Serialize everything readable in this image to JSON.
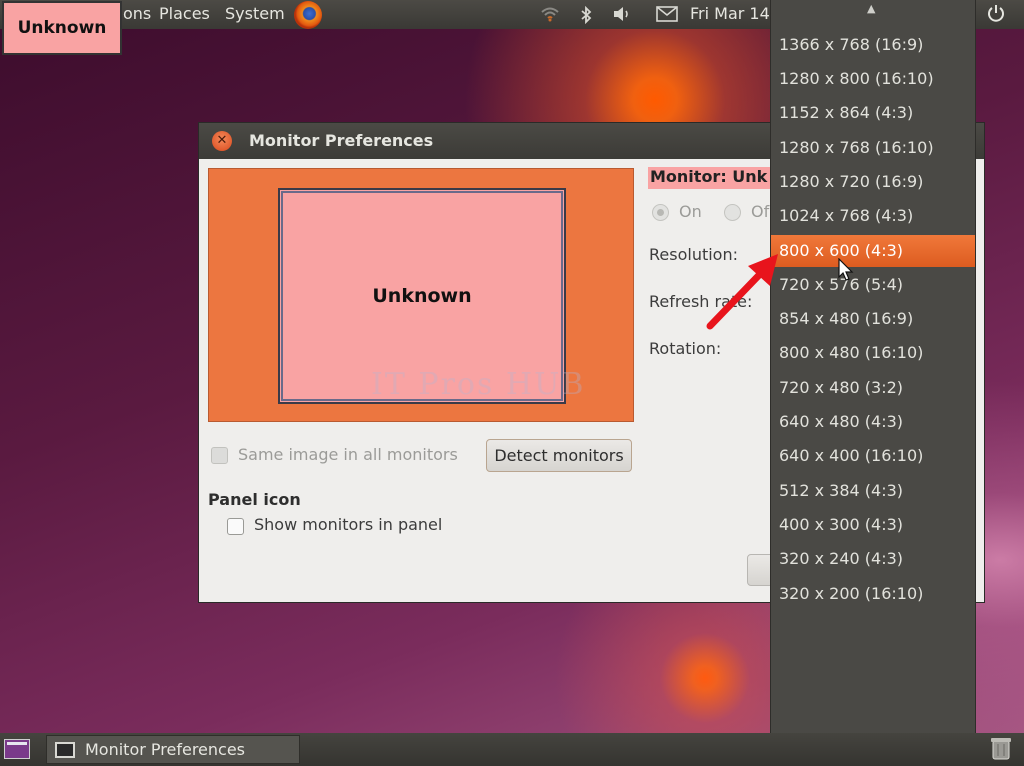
{
  "top_panel": {
    "menu_applications_partial": "ons",
    "menu_places": "Places",
    "menu_system": "System",
    "clock": "Fri Mar 14",
    "icons": [
      "firefox-icon",
      "wifi-icon",
      "bluetooth-icon",
      "volume-icon",
      "mail-icon",
      "power-icon"
    ]
  },
  "overlay_badge": {
    "label": "Unknown"
  },
  "window": {
    "title": "Monitor Preferences",
    "preview_monitor_label": "Unknown",
    "watermark": "IT Pros HUB",
    "monitor_label": "Monitor: Unk",
    "radio_on": "On",
    "radio_off": "Of",
    "radio_on_selected": true,
    "resolution_label": "Resolution:",
    "refresh_label": "Refresh rate:",
    "rotation_label": "Rotation:",
    "same_image_label": "Same image in all monitors",
    "same_image_checked": false,
    "detect_button": "Detect monitors",
    "panel_icon_heading": "Panel icon",
    "show_monitors_label": "Show monitors in panel",
    "show_monitors_checked": false
  },
  "resolution_dropdown": {
    "selected_index": 6,
    "options": [
      "1366 x 768 (16:9)",
      "1280 x 800 (16:10)",
      "1152 x 864 (4:3)",
      "1280 x 768 (16:10)",
      "1280 x 720 (16:9)",
      "1024 x 768 (4:3)",
      "800 x 600 (4:3)",
      "720 x 576 (5:4)",
      "854 x 480 (16:9)",
      "800 x 480 (16:10)",
      "720 x 480 (3:2)",
      "640 x 480 (4:3)",
      "640 x 400 (16:10)",
      "512 x 384 (4:3)",
      "400 x 300 (4:3)",
      "320 x 240 (4:3)",
      "320 x 200 (16:10)"
    ]
  },
  "bottom_panel": {
    "task_label": "Monitor Preferences"
  },
  "colors": {
    "accent_orange": "#ec7640",
    "monitor_pink": "#f9a3a3",
    "selection_orange": "#e8692c",
    "annotation_red": "#e8141c"
  }
}
